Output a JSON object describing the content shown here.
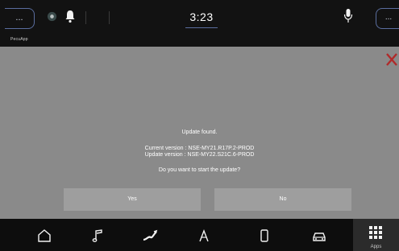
{
  "status_bar": {
    "left_button_label": "...",
    "right_button_label": "...",
    "time": "3:23",
    "app_label": "PecuApp"
  },
  "dialog": {
    "title": "Update found.",
    "current_version": "Current version : NSE-MY21.R17P.2-PROD",
    "update_version": "Update version : NSE-MY22.S21C.6-PROD",
    "question": "Do you want to start the update?",
    "yes_label": "Yes",
    "no_label": "No",
    "close_color": "#b02a2a"
  },
  "nav_bar": {
    "items": [
      {
        "icon": "home-icon"
      },
      {
        "icon": "music-note-icon"
      },
      {
        "icon": "navigation-icon"
      },
      {
        "icon": "a-icon"
      },
      {
        "icon": "phone-icon"
      },
      {
        "icon": "car-icon"
      }
    ],
    "apps_label": "Apps"
  },
  "colors": {
    "accent": "#5a6d9e",
    "dialog_bg": "#8a8a8a",
    "button_bg": "#9e9e9e"
  }
}
